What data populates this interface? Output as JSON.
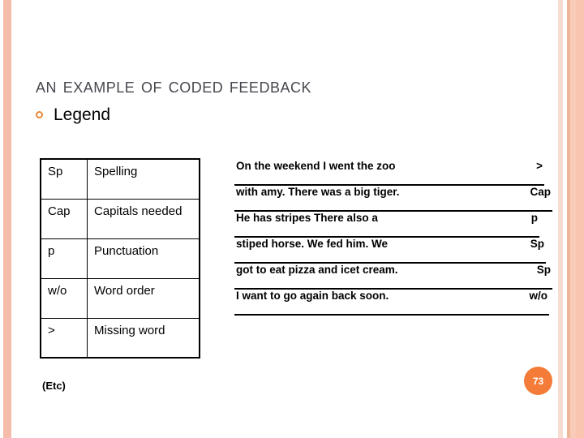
{
  "slide": {
    "title": "An example of Coded Feedback",
    "page_number": "73",
    "accent_color": "#F47B38",
    "stripe_color": "#F5BCA9",
    "title_color": "#46484F"
  },
  "legend": {
    "bullet_icon": "hollow-circle-bullet",
    "heading": "Legend",
    "footnote": "(Etc)",
    "rows": [
      {
        "code": "Sp",
        "meaning": "Spelling"
      },
      {
        "code": "Cap",
        "meaning": "Capitals needed"
      },
      {
        "code": "p",
        "meaning": "Punctuation"
      },
      {
        "code": "w/o",
        "meaning": "Word order"
      },
      {
        "code": ">",
        "meaning": "Missing word"
      }
    ]
  },
  "sample": {
    "lines": [
      {
        "text": "On the weekend I went the zoo",
        "code": ">"
      },
      {
        "text": "with amy. There was a big tiger.",
        "code": "Cap"
      },
      {
        "text": "He has stripes There also a",
        "code": "p"
      },
      {
        "text": "stiped horse. We fed him. We",
        "code": "Sp"
      },
      {
        "text": "got to eat pizza and icet cream.",
        "code": "Sp"
      },
      {
        "text": "I want to go again back soon.",
        "code": "w/o"
      }
    ]
  }
}
